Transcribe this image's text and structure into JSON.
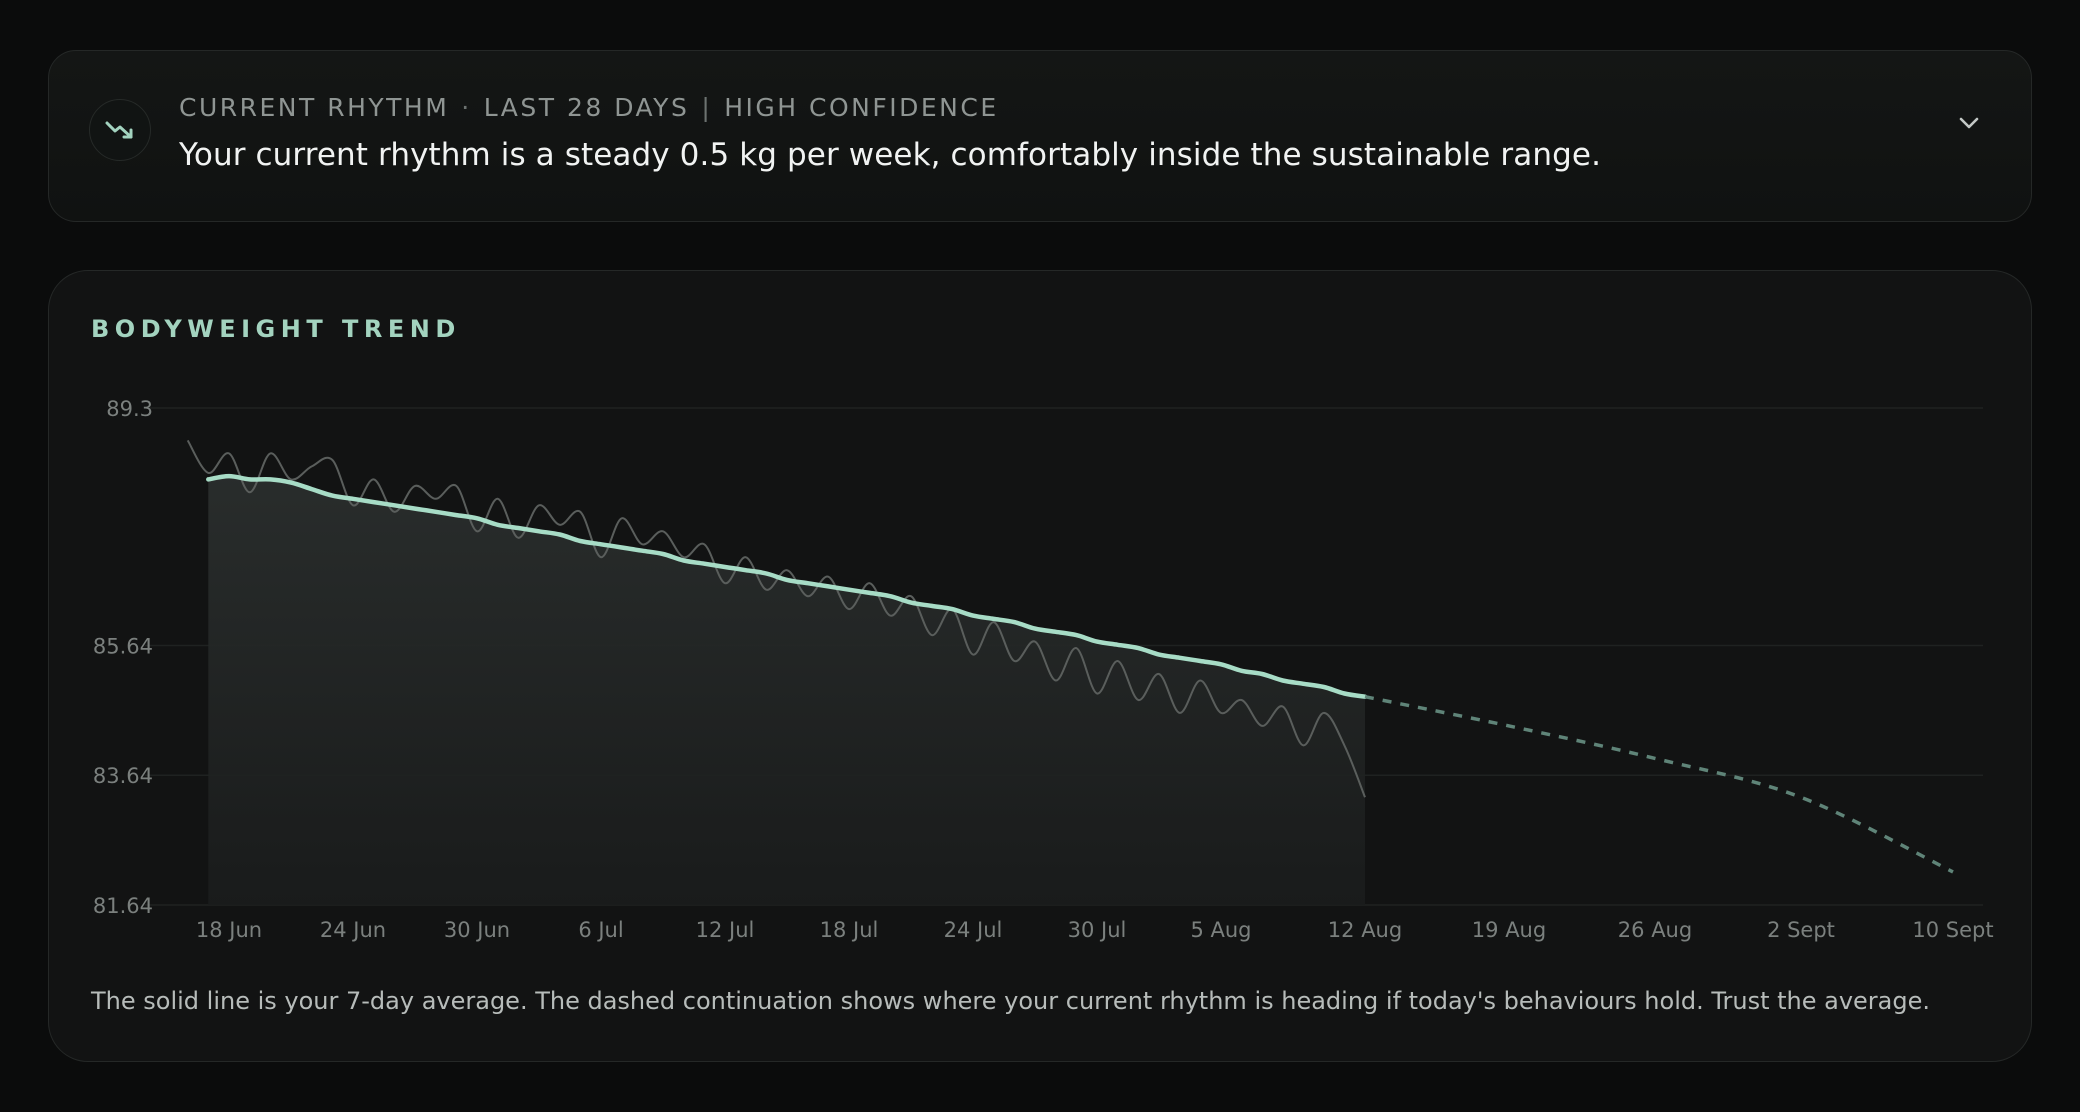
{
  "rhythm": {
    "label": "CURRENT RHYTHM",
    "separator_dot": "·",
    "window": "LAST 28 DAYS",
    "separator_bar": "|",
    "confidence": "HIGH CONFIDENCE",
    "message": "Your current rhythm is a steady 0.5 kg per week, comfortably inside the sustainable range.",
    "icon": "trending-down-icon",
    "toggle_icon": "chevron-down-icon"
  },
  "trend": {
    "title": "BODYWEIGHT TREND",
    "footnote": "The solid line is your 7-day average. The dashed continuation shows where your current rhythm is heading if today's behaviours hold. Trust the average."
  },
  "colors": {
    "accent": "#a3d3bf",
    "trend_line": "#a7dcc6",
    "raw_line": "#5a5e5c",
    "projection": "#5f8478",
    "background": "#0b0c0c",
    "card": "#121313"
  },
  "chart_data": {
    "type": "line",
    "y_ticks": [
      "89.3",
      "85.64",
      "83.64",
      "81.64"
    ],
    "x_ticks": [
      "18 Jun",
      "24 Jun",
      "30 Jun",
      "6 Jul",
      "12 Jul",
      "18 Jul",
      "24 Jul",
      "30 Jul",
      "5 Aug",
      "12 Aug",
      "19 Aug",
      "26 Aug",
      "2 Sept",
      "10 Sept"
    ],
    "series": [
      {
        "style": "raw-daily",
        "x": [
          "16 Jun",
          "17 Jun",
          "18 Jun",
          "19 Jun",
          "20 Jun",
          "21 Jun",
          "22 Jun",
          "23 Jun",
          "24 Jun",
          "25 Jun",
          "26 Jun",
          "27 Jun",
          "28 Jun",
          "29 Jun",
          "30 Jun",
          "1 Jul",
          "2 Jul",
          "3 Jul",
          "4 Jul",
          "5 Jul",
          "6 Jul",
          "7 Jul",
          "8 Jul",
          "9 Jul",
          "10 Jul",
          "11 Jul",
          "12 Jul",
          "13 Jul",
          "14 Jul",
          "15 Jul",
          "16 Jul",
          "17 Jul",
          "18 Jul",
          "19 Jul",
          "20 Jul",
          "21 Jul",
          "22 Jul",
          "23 Jul",
          "24 Jul",
          "25 Jul",
          "26 Jul",
          "27 Jul",
          "28 Jul",
          "29 Jul",
          "30 Jul",
          "31 Jul",
          "1 Aug",
          "2 Aug",
          "3 Aug",
          "4 Aug",
          "5 Aug",
          "6 Aug",
          "7 Aug",
          "8 Aug",
          "9 Aug",
          "10 Aug",
          "11 Aug",
          "12 Aug"
        ],
        "values": [
          88.8,
          88.3,
          88.6,
          88.0,
          88.6,
          88.2,
          88.4,
          88.5,
          87.8,
          88.2,
          87.7,
          88.1,
          87.9,
          88.1,
          87.4,
          87.9,
          87.3,
          87.8,
          87.5,
          87.7,
          87.0,
          87.6,
          87.2,
          87.4,
          87.0,
          87.2,
          86.6,
          87.0,
          86.5,
          86.8,
          86.4,
          86.7,
          86.2,
          86.6,
          86.1,
          86.4,
          85.8,
          86.2,
          85.5,
          86.0,
          85.4,
          85.7,
          85.1,
          85.6,
          84.9,
          85.4,
          84.8,
          85.2,
          84.6,
          85.1,
          84.6,
          84.8,
          84.4,
          84.7,
          84.1,
          84.6,
          84.1,
          83.3
        ]
      },
      {
        "style": "7-day-average",
        "x": [
          "16 Jun",
          "17 Jun",
          "18 Jun",
          "19 Jun",
          "20 Jun",
          "21 Jun",
          "22 Jun",
          "23 Jun",
          "24 Jun",
          "25 Jun",
          "26 Jun",
          "27 Jun",
          "28 Jun",
          "29 Jun",
          "30 Jun",
          "1 Jul",
          "2 Jul",
          "3 Jul",
          "4 Jul",
          "5 Jul",
          "6 Jul",
          "7 Jul",
          "8 Jul",
          "9 Jul",
          "10 Jul",
          "11 Jul",
          "12 Jul",
          "13 Jul",
          "14 Jul",
          "15 Jul",
          "16 Jul",
          "17 Jul",
          "18 Jul",
          "19 Jul",
          "20 Jul",
          "21 Jul",
          "22 Jul",
          "23 Jul",
          "24 Jul",
          "25 Jul",
          "26 Jul",
          "27 Jul",
          "28 Jul",
          "29 Jul",
          "30 Jul",
          "31 Jul",
          "1 Aug",
          "2 Aug",
          "3 Aug",
          "4 Aug",
          "5 Aug",
          "6 Aug",
          "7 Aug",
          "8 Aug",
          "9 Aug",
          "10 Aug",
          "11 Aug",
          "12 Aug"
        ],
        "values": [
          88.45,
          88.2,
          88.25,
          88.2,
          88.2,
          88.15,
          88.05,
          87.95,
          87.9,
          87.85,
          87.8,
          87.75,
          87.7,
          87.65,
          87.6,
          87.5,
          87.45,
          87.4,
          87.35,
          87.25,
          87.2,
          87.15,
          87.1,
          87.05,
          86.95,
          86.9,
          86.85,
          86.8,
          86.75,
          86.65,
          86.6,
          86.55,
          86.5,
          86.45,
          86.4,
          86.3,
          86.25,
          86.2,
          86.1,
          86.05,
          86.0,
          85.9,
          85.85,
          85.8,
          85.7,
          85.65,
          85.6,
          85.5,
          85.45,
          85.4,
          85.35,
          85.25,
          85.2,
          85.1,
          85.05,
          85.0,
          84.9,
          84.85
        ]
      },
      {
        "style": "projection",
        "x": [
          "12 Aug",
          "19 Aug",
          "26 Aug",
          "2 Sept",
          "10 Sept"
        ],
        "values": [
          84.85,
          84.4,
          83.9,
          83.3,
          82.15
        ]
      }
    ],
    "ylim": [
      81.64,
      89.3
    ]
  }
}
